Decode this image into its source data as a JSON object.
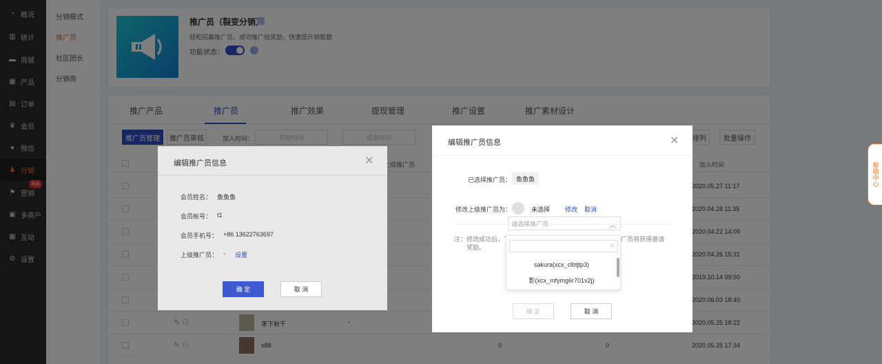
{
  "nav": {
    "items": [
      {
        "icon": "gauge-icon",
        "label": "概况"
      },
      {
        "icon": "chart-icon",
        "label": "统计"
      },
      {
        "icon": "shop-icon",
        "label": "商城"
      },
      {
        "icon": "grid-icon",
        "label": "产品"
      },
      {
        "icon": "list-icon",
        "label": "订单"
      },
      {
        "icon": "crown-icon",
        "label": "会员"
      },
      {
        "icon": "wechat-icon",
        "label": "微信"
      },
      {
        "icon": "share-icon",
        "label": "分销"
      },
      {
        "icon": "flag-icon",
        "label": "营销"
      },
      {
        "icon": "store-icon",
        "label": "多商户"
      },
      {
        "icon": "apps-icon",
        "label": "互动"
      },
      {
        "icon": "gear-icon",
        "label": "设置"
      }
    ],
    "hot_badge": "hot"
  },
  "subnav": {
    "items": [
      "分销模式",
      "推广员",
      "社区团长",
      "分销商"
    ]
  },
  "promo": {
    "title": "推广员（裂变分销）",
    "desc": "轻松招募推广员，成功推广给奖励，快速提升销售额",
    "status_label": "功能状态："
  },
  "tabs": [
    "推广产品",
    "推广员",
    "推广效果",
    "提现管理",
    "推广设置",
    "推广素材设计"
  ],
  "filters": {
    "btn_manage": "推广员管理",
    "btn_review": "推广员审核",
    "join_time_label": "加入时间：",
    "start_placeholder": "开始时间",
    "end_placeholder": "结束时间",
    "sort_btn": "排列",
    "batch_btn": "批量操作"
  },
  "table": {
    "col_parent": "上级推广员",
    "col_join": "加入时间",
    "rows": [
      {
        "date": "2020.05.27 11:17"
      },
      {
        "date": "2020.04.28 11:35"
      },
      {
        "date": "2020.04.22 14:09"
      },
      {
        "date": "2020.04.26 15:31"
      },
      {
        "date": "2019.10.14 09:50"
      },
      {
        "date": "2020.06.03 18:40"
      },
      {
        "date": "2020.05.25 18:22",
        "name": "李下秋千",
        "dash": "-"
      },
      {
        "date": "2020.05.25 17:34",
        "name": "s88",
        "zero1": "0",
        "zero2": "0"
      }
    ]
  },
  "help": {
    "label": "帮助中心"
  },
  "modal1": {
    "title": "编辑推广员信息",
    "name_label": "会员姓名：",
    "name_value": "鱼鱼鱼",
    "account_label": "会员帐号：",
    "account_value": "t1",
    "phone_label": "会员手机号：",
    "phone_value": "+86 13622763697",
    "parent_label": "上级推广员：",
    "parent_value": "-",
    "parent_link": "设置",
    "ok": "确 定",
    "cancel": "取 消"
  },
  "modal2": {
    "title": "编辑推广员信息",
    "selected_label": "已选择推广员：",
    "selected_value": "鱼鱼鱼",
    "change_label": "修改上级推广员为：",
    "unselected": "未选择",
    "edit_link": "修改",
    "cancel_link": "取消",
    "select_placeholder": "请选择推广员",
    "note_prefix": "注：修改成功后，下",
    "note_suffix": "广员将获得邀请",
    "note_line2": "奖励。",
    "options": [
      "sakura(xcx_clbtjtp3)",
      "影(xcx_mfymg6r701v2j)"
    ],
    "more": "· · · ·",
    "ok": "确 定",
    "cancel": "取 消"
  },
  "colors": {
    "accent": "#2e4dc4",
    "orange": "#ff6a2b"
  }
}
